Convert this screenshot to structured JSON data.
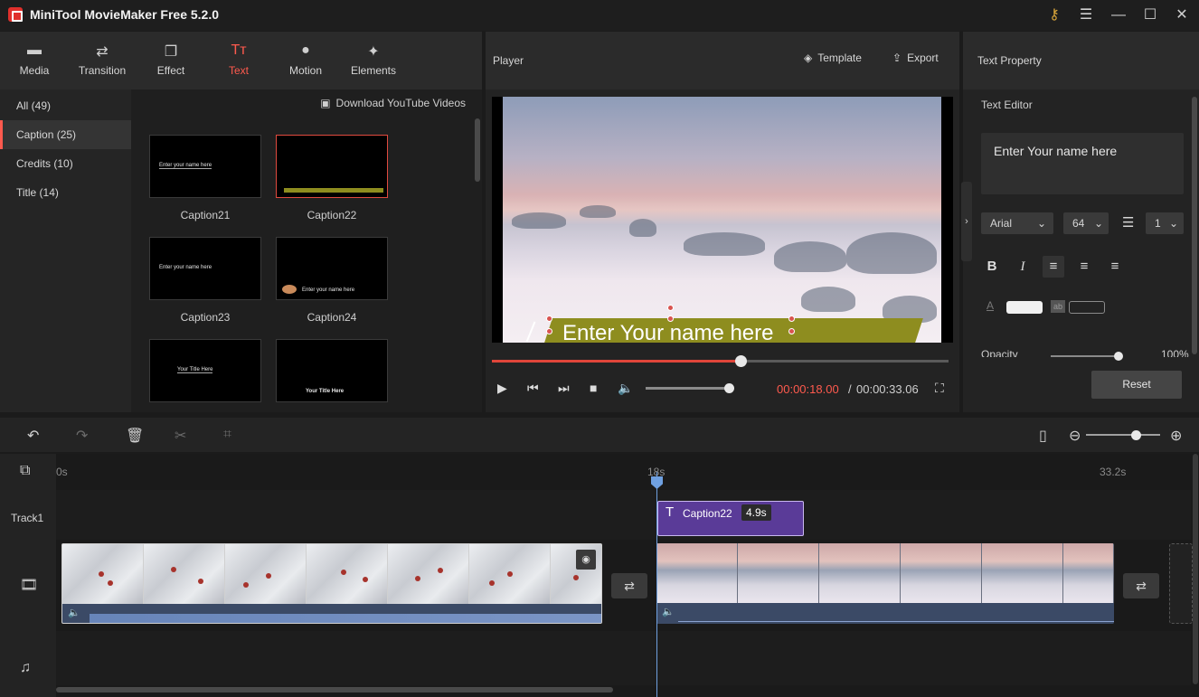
{
  "titlebar": {
    "title": "MiniTool MovieMaker Free 5.2.0"
  },
  "toolbar": {
    "tabs": [
      "Media",
      "Transition",
      "Effect",
      "Text",
      "Motion",
      "Elements"
    ],
    "active": "Text"
  },
  "library": {
    "categories": [
      "All (49)",
      "Caption (25)",
      "Credits (10)",
      "Title (14)"
    ],
    "download_link": "Download YouTube Videos",
    "items": [
      "Caption21",
      "Caption22",
      "Caption23",
      "Caption24"
    ],
    "thumb_texts": [
      "Enter your name here",
      "Enter your name here",
      "Enter your name here",
      "Your Title Here",
      "Your  Title Here"
    ]
  },
  "player": {
    "title": "Player",
    "template_label": "Template",
    "export_label": "Export",
    "caption_text": "Enter Your name here",
    "progress": 0.545,
    "volume": 0.95,
    "time_current": "00:00:18.00",
    "time_sep": "/",
    "time_total": "00:00:33.06"
  },
  "text_property": {
    "title": "Text Property",
    "editor_label": "Text Editor",
    "editor_text": "Enter Your name here",
    "font": "Arial",
    "size": "64",
    "line_spacing": "1",
    "opacity_label": "Opacity",
    "opacity_value": "100%",
    "reset_label": "Reset"
  },
  "timeline": {
    "ruler": [
      "0s",
      "18s",
      "33.2s"
    ],
    "track1_label": "Track1",
    "caption_clip": {
      "name": "Caption22",
      "duration": "4.9s"
    }
  },
  "colors": {
    "accent": "#ff5a4e",
    "clip_purple": "#5a3b98",
    "playhead": "#6fa0e0"
  }
}
